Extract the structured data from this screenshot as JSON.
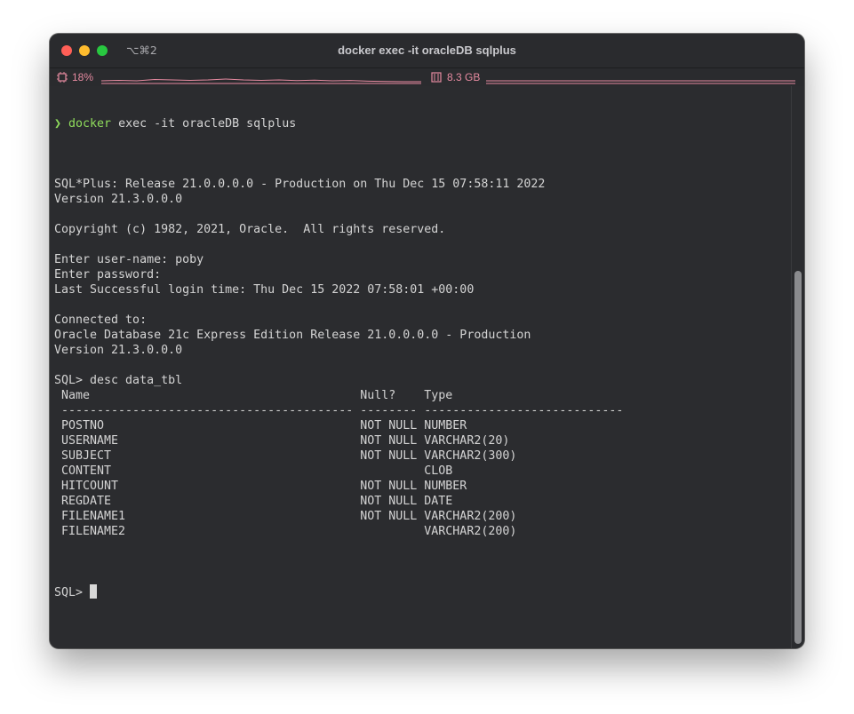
{
  "window": {
    "title": "docker exec -it oracleDB sqlplus",
    "shortcut": "⌥⌘2"
  },
  "status": {
    "cpu_label": "18%",
    "cpu_icon": "cpu-chip-icon",
    "mem_label": "8.3 GB",
    "mem_icon": "memory-icon",
    "accent_color": "#e58aa0"
  },
  "terminal": {
    "prompt_symbol": "❯",
    "command_name": "docker",
    "command_args": " exec -it oracleDB sqlplus",
    "output_lines": [
      "",
      "SQL*Plus: Release 21.0.0.0.0 - Production on Thu Dec 15 07:58:11 2022",
      "Version 21.3.0.0.0",
      "",
      "Copyright (c) 1982, 2021, Oracle.  All rights reserved.",
      "",
      "Enter user-name: poby",
      "Enter password:",
      "Last Successful login time: Thu Dec 15 2022 07:58:01 +00:00",
      "",
      "Connected to:",
      "Oracle Database 21c Express Edition Release 21.0.0.0.0 - Production",
      "Version 21.3.0.0.0",
      "",
      "SQL> desc data_tbl",
      " Name                                      Null?    Type",
      " ----------------------------------------- -------- ----------------------------",
      " POSTNO                                    NOT NULL NUMBER",
      " USERNAME                                  NOT NULL VARCHAR2(20)",
      " SUBJECT                                   NOT NULL VARCHAR2(300)",
      " CONTENT                                            CLOB",
      " HITCOUNT                                  NOT NULL NUMBER",
      " REGDATE                                   NOT NULL DATE",
      " FILENAME1                                 NOT NULL VARCHAR2(200)",
      " FILENAME2                                          VARCHAR2(200)",
      ""
    ],
    "final_prompt": "SQL> "
  }
}
